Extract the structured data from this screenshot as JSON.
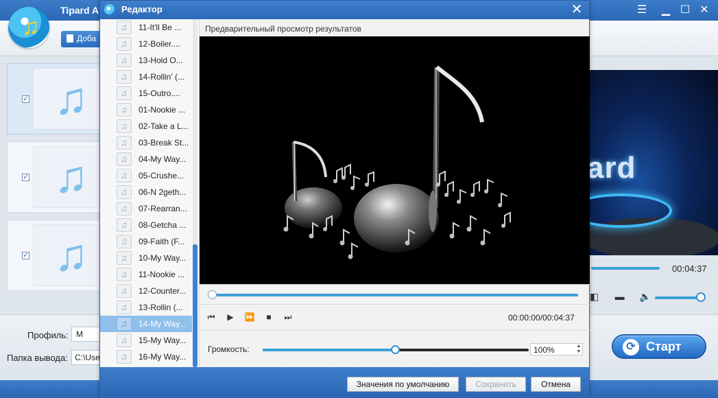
{
  "app": {
    "title": "Tipard A",
    "add_label": "Доба",
    "profile_label": "Профиль:",
    "profile_value": "M",
    "folder_label": "Папка вывода:",
    "folder_value": "C:\\Use",
    "right_time": "00:04:37",
    "right_brand": "ard",
    "start_label": "Старт",
    "files": [
      {
        "checked": true
      },
      {
        "checked": true
      },
      {
        "checked": true
      }
    ]
  },
  "dialog": {
    "title": "Редактор",
    "preview_label": "Предварительный просмотр результатов",
    "time_display": "00:00:00/00:04:37",
    "volume_label": "Громкость:",
    "volume_value": "100%",
    "volume_level": 0.5,
    "buttons": {
      "defaults": "Значения по умолчанию",
      "save": "Сохранить",
      "cancel": "Отмена"
    },
    "tracks": [
      {
        "name": "11-It'll Be ..."
      },
      {
        "name": "12-Boiler...."
      },
      {
        "name": "13-Hold O..."
      },
      {
        "name": "14-Rollin' (..."
      },
      {
        "name": "15-Outro...."
      },
      {
        "name": "01-Nookie ..."
      },
      {
        "name": "02-Take a L..."
      },
      {
        "name": "03-Break St..."
      },
      {
        "name": "04-My Way..."
      },
      {
        "name": "05-Crushe..."
      },
      {
        "name": "06-N 2geth..."
      },
      {
        "name": "07-Rearran..."
      },
      {
        "name": "08-Getcha ..."
      },
      {
        "name": "09-Faith (F..."
      },
      {
        "name": "10-My Way..."
      },
      {
        "name": "11-Nookie ..."
      },
      {
        "name": "12-Counter..."
      },
      {
        "name": "13-Rollin (..."
      },
      {
        "name": "14-My Way...",
        "selected": true
      },
      {
        "name": "15-My Way..."
      },
      {
        "name": "16-My Way..."
      }
    ]
  },
  "colors": {
    "titlebar": "#2c68b6",
    "accent": "#3aa0d8",
    "selected_row": "#8fc0ec",
    "note_blue": "#7fbfec"
  },
  "icons": {
    "play": "▶",
    "stop": "■",
    "prev": "⏮",
    "next": "⏭",
    "fast_forward": "⏩",
    "close": "✕",
    "note": "♫"
  }
}
